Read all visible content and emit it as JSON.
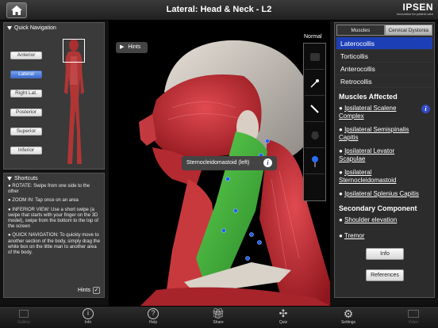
{
  "header": {
    "title": "Lateral: Head & Neck - L2",
    "brand": "IPSEN",
    "tagline": "Innovation for patient care"
  },
  "quick_nav": {
    "title": "Quick Navigation",
    "buttons": [
      "Anterior",
      "Lateral",
      "Right Lat.",
      "Posterior",
      "Superior",
      "Inferior"
    ],
    "active": "Lateral"
  },
  "shortcuts": {
    "title": "Shortcuts",
    "items": [
      "● ROTATE: Swipe from one side to the other",
      "● ZOOM IN: Tap once on an area",
      "● INFERIOR VIEW: Use a short swipe (a swipe that starts with your finger on the 3D model), swipe from the bottom to the top of the screen",
      "● QUICK NAVIGATION: To quickly move to another section of the body, simply drag the white box on the little man to another area of the body."
    ],
    "hints_label": "Hints",
    "hints_checked": true
  },
  "viewport": {
    "hints_button": "Hints",
    "tool_mode": "Normal",
    "selected_label": "Sternocleidomastoid (left)"
  },
  "right": {
    "tabs": [
      "Muscles",
      "Cervical Dystonia"
    ],
    "active_tab": "Cervical Dystonia",
    "conditions": [
      "Laterocollis",
      "Torticollis",
      "Anterocollis",
      "Retrocollis"
    ],
    "active_condition": "Laterocollis",
    "muscles_title": "Muscles Affected",
    "muscles": [
      "Ipsilateral Scalene Complex",
      "Ipsilateral Semispinalis Capitis",
      "Ipsilateral Levator Scapulae",
      "Ipsilateral Sternocleidomastoid",
      "Ipsilateral Splenius Capitis"
    ],
    "secondary_title": "Secondary Component",
    "secondary": [
      "Shoulder elevation",
      "Tremor"
    ],
    "info_button": "Info",
    "references_button": "References"
  },
  "bottom_nav": [
    "Gallery",
    "Info",
    "Help",
    "Share",
    "Quiz",
    "Settings",
    "Video"
  ],
  "colors": {
    "accent": "#1d3fb6",
    "muscle_red": "#b8222a",
    "highlight_green": "#3fae3a"
  }
}
